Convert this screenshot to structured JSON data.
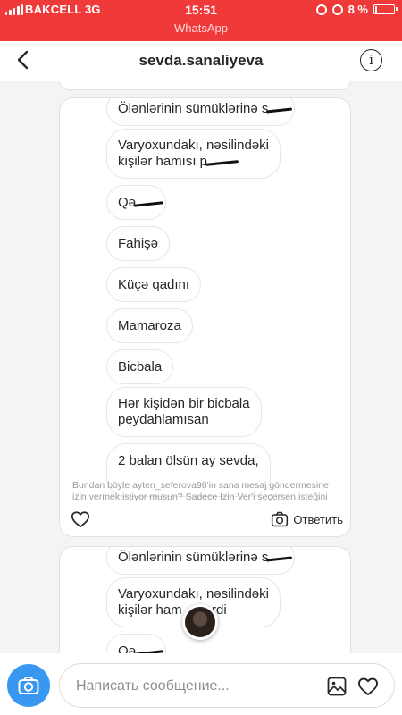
{
  "status_bar": {
    "carrier": "BAKCELL",
    "network": "3G",
    "time": "15:51",
    "battery": "8 %",
    "battery_level": 0.08,
    "back_app": "WhatsApp",
    "color": "#f03a3a"
  },
  "header": {
    "title": "sevda.sanaliyeva",
    "back_icon": "chevron-left-icon",
    "info_icon": "info-icon",
    "info_glyph": "i"
  },
  "request_card": {
    "messages": [
      "Ölənlərinin sümüklərinə s",
      "Varyoxundakı, nəsilindəki",
      "kişilər hamısı p",
      "Qə",
      "Fahişə",
      "Küçə qadını",
      "Mamaroza",
      "Bicbala",
      "Hər kişidən bir bicbala",
      "peydahlamısan",
      "2 balan ölsün ay sevda,"
    ],
    "prompt_line1": "Bundan böyle ayten_seferova96'in sana mesaj göndermesine",
    "prompt_line2": "izin vermek istiyor musun? Sadece İzin Ver'i seçersen isteğini",
    "reply_label": "Ответить"
  },
  "request_card_2": {
    "messages": [
      "Ölənlərinin sümüklərinə s",
      "Varyoxundakı, nəsilindəki",
      "kişilər ham",
      "rdi",
      "Qə"
    ]
  },
  "composer": {
    "placeholder": "Написать сообщение...",
    "accent": "#3897f0"
  }
}
